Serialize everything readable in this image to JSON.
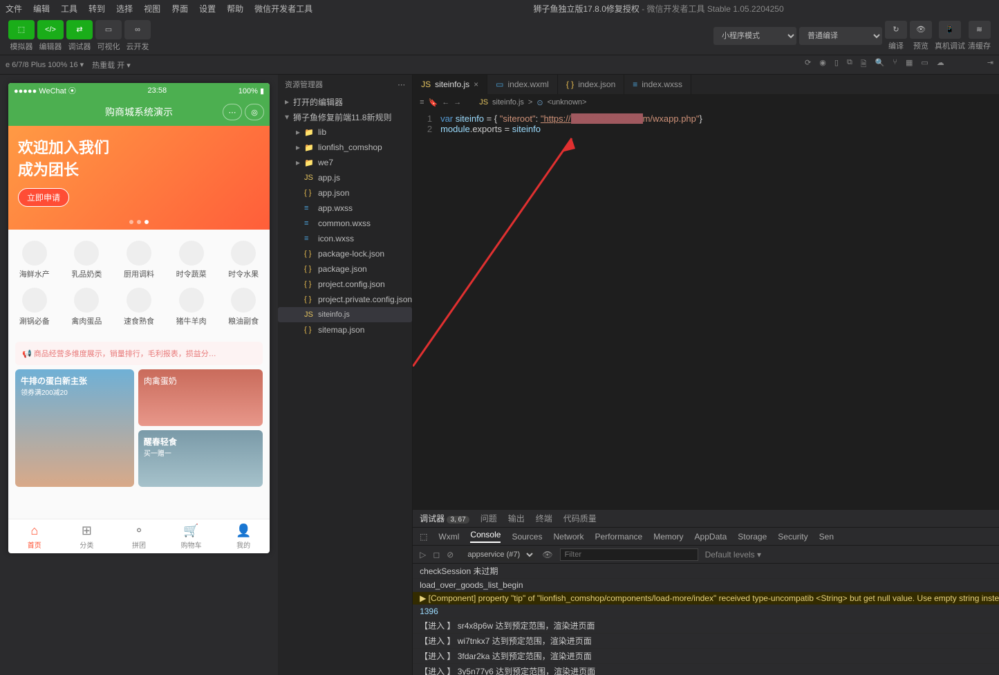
{
  "menubar": {
    "items": [
      "文件",
      "编辑",
      "工具",
      "转到",
      "选择",
      "视图",
      "界面",
      "设置",
      "帮助",
      "微信开发者工具"
    ],
    "app_title": "狮子鱼独立版17.8.0修复授权",
    "suffix": " - 微信开发者工具 Stable 1.05.2204250"
  },
  "toolbar": {
    "buttons": [
      "模拟器",
      "编辑器",
      "调试器",
      "可视化",
      "云开发"
    ],
    "mode": "小程序模式",
    "compile": "普通编译",
    "icons": {
      "compile_label": "编译",
      "preview_label": "预览",
      "realdev_label": "真机调试",
      "clearcache_label": "清缓存"
    }
  },
  "devicebar": {
    "device": "e 6/7/8 Plus 100% 16 ▾",
    "hotreload": "热重载 开 ▾"
  },
  "simulator": {
    "status": {
      "carrier": "●●●●● WeChat ⦿",
      "time": "23:58",
      "battery": "100%"
    },
    "header_title": "购商城系统演示",
    "banner": {
      "l1": "欢迎加入我们",
      "l2": "成为团长",
      "apply": "立即申请"
    },
    "cats": [
      "海鲜水产",
      "乳品奶类",
      "厨用调料",
      "时令蔬菜",
      "时令水果",
      "涮锅必备",
      "禽肉蛋品",
      "速食熟食",
      "猪牛羊肉",
      "粮油副食"
    ],
    "notice": "📢 商品经营多维度展示，销量排行，毛利报表，损益分…",
    "promos": {
      "left_t": "牛排の蛋白新主张",
      "left_s": "领券满200减20",
      "r1": "肉禽蛋奶",
      "r2_t": "醒春轻食",
      "r2_s": "买一赠一"
    },
    "tabs": [
      "首页",
      "分类",
      "拼团",
      "购物车",
      "我的"
    ]
  },
  "explorer": {
    "title": "资源管理器",
    "open_editors": "打开的编辑器",
    "project": "狮子鱼修复前端11.8新规则",
    "tree": [
      {
        "name": "lib",
        "type": "folder",
        "indent": 1
      },
      {
        "name": "lionfish_comshop",
        "type": "folder",
        "indent": 1
      },
      {
        "name": "we7",
        "type": "folder",
        "indent": 1
      },
      {
        "name": "app.js",
        "type": "js",
        "indent": 1
      },
      {
        "name": "app.json",
        "type": "json",
        "indent": 1
      },
      {
        "name": "app.wxss",
        "type": "wxss",
        "indent": 1
      },
      {
        "name": "common.wxss",
        "type": "wxss",
        "indent": 1
      },
      {
        "name": "icon.wxss",
        "type": "wxss",
        "indent": 1
      },
      {
        "name": "package-lock.json",
        "type": "json",
        "indent": 1
      },
      {
        "name": "package.json",
        "type": "json",
        "indent": 1
      },
      {
        "name": "project.config.json",
        "type": "json",
        "indent": 1
      },
      {
        "name": "project.private.config.json",
        "type": "json",
        "indent": 1
      },
      {
        "name": "siteinfo.js",
        "type": "js",
        "indent": 1,
        "sel": true
      },
      {
        "name": "sitemap.json",
        "type": "json",
        "indent": 1
      }
    ]
  },
  "editor": {
    "tabs": [
      {
        "name": "siteinfo.js",
        "icon": "js",
        "active": true,
        "close": true
      },
      {
        "name": "index.wxml",
        "icon": "wxml"
      },
      {
        "name": "index.json",
        "icon": "json"
      },
      {
        "name": "index.wxss",
        "icon": "wxss"
      }
    ],
    "breadcrumb": {
      "file": "siteinfo.js",
      "sep": ">",
      "sym": "⊙",
      "unk": "<unknown>"
    },
    "code": {
      "kw_var": "var",
      "id_siteinfo": "siteinfo",
      "eq": " = { ",
      "key_root": "\"siteroot\"",
      "colon": ": ",
      "url_pre": "\"https://",
      "url_post": "m/wxapp.php\"",
      "close": "}",
      "module": "module",
      "dot_exports": ".exports",
      "eq2": " = ",
      "siteinfo2": "siteinfo"
    }
  },
  "panel": {
    "tabs": [
      "调试器",
      "问题",
      "输出",
      "终端",
      "代码质量"
    ],
    "badge": "3, 67",
    "devtools": [
      "Wxml",
      "Console",
      "Sources",
      "Network",
      "Performance",
      "Memory",
      "AppData",
      "Storage",
      "Security",
      "Sen"
    ],
    "console_ctx": "appservice (#7)",
    "filter_placeholder": "Filter",
    "levels": "Default levels ▾",
    "logs": [
      {
        "type": "log",
        "text": "checkSession 未过期"
      },
      {
        "type": "log",
        "text": "load_over_goods_list_begin"
      },
      {
        "type": "warn",
        "text": "▶ [Component] property \"tip\" of \"lionfish_comshop/components/load-more/index\" received type-uncompatib <String> but get null value. Use empty string instead."
      },
      {
        "type": "num",
        "text": "1396"
      },
      {
        "type": "log",
        "text": "【进入 】 sr4x8p6w 达到预定范围，渲染进页面"
      },
      {
        "type": "log",
        "text": "【进入 】 wi7tnkx7 达到预定范围，渲染进页面"
      },
      {
        "type": "log",
        "text": "【进入 】 3fdar2ka 达到预定范围，渲染进页面"
      },
      {
        "type": "log",
        "text": "【进入 】 3y5n77y6 达到预定范围，渲染进页面"
      }
    ]
  }
}
